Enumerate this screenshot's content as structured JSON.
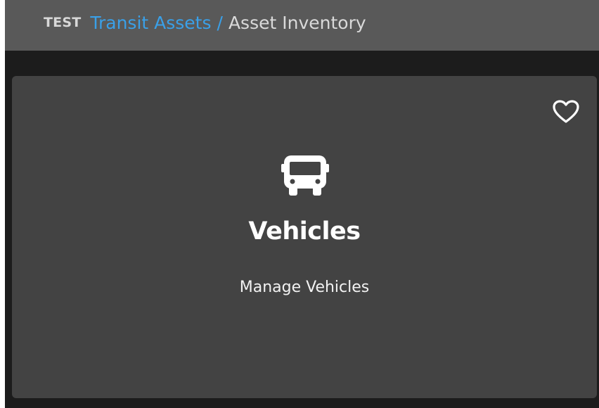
{
  "header": {
    "environment": "TEST",
    "breadcrumb": {
      "parent": "Transit Assets",
      "separator": "/",
      "current": "Asset Inventory"
    }
  },
  "card": {
    "icon": "bus-icon",
    "favorite_icon": "heart-outline-icon",
    "title": "Vehicles",
    "subtitle": "Manage Vehicles"
  },
  "colors": {
    "background": "#1c1c1c",
    "header": "#595959",
    "card": "#434343",
    "link": "#3aa0e8",
    "text": "#ffffff"
  }
}
